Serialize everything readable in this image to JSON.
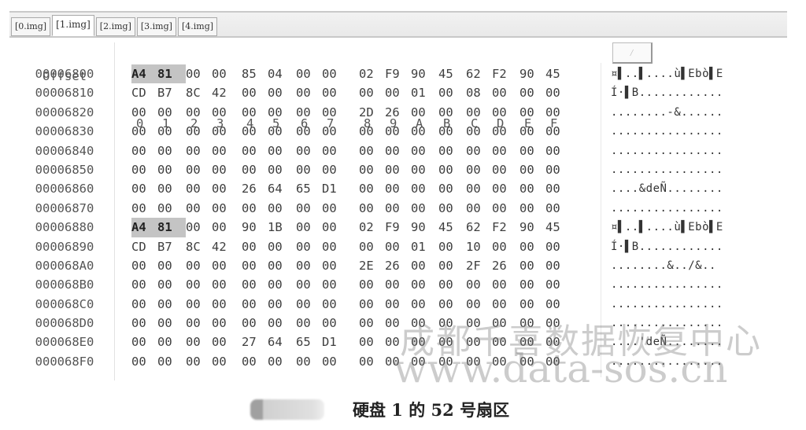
{
  "tabs": [
    {
      "label": "[0.img]",
      "active": false
    },
    {
      "label": "[1.img]",
      "active": true
    },
    {
      "label": "[2.img]",
      "active": false
    },
    {
      "label": "[3.img]",
      "active": false
    },
    {
      "label": "[4.img]",
      "active": false
    }
  ],
  "header": {
    "offset_label": "Offset",
    "columns": [
      "0",
      "1",
      "2",
      "3",
      "4",
      "5",
      "6",
      "7",
      "8",
      "9",
      "A",
      "B",
      "C",
      "D",
      "E",
      "F"
    ],
    "ascii_box_glyph": "⁄"
  },
  "rows": [
    {
      "offset": "00006800",
      "bytes": [
        "A4",
        "81",
        "00",
        "00",
        "85",
        "04",
        "00",
        "00",
        "02",
        "F9",
        "90",
        "45",
        "62",
        "F2",
        "90",
        "45"
      ],
      "highlight": [
        0,
        1
      ],
      "ascii": "¤▌..▌....ù▌Ebò▌E"
    },
    {
      "offset": "00006810",
      "bytes": [
        "CD",
        "B7",
        "8C",
        "42",
        "00",
        "00",
        "00",
        "00",
        "00",
        "00",
        "01",
        "00",
        "08",
        "00",
        "00",
        "00"
      ],
      "highlight": [],
      "ascii": "Í·▌B............"
    },
    {
      "offset": "00006820",
      "bytes": [
        "00",
        "00",
        "00",
        "00",
        "00",
        "00",
        "00",
        "00",
        "2D",
        "26",
        "00",
        "00",
        "00",
        "00",
        "00",
        "00"
      ],
      "highlight": [],
      "ascii": "........-&......"
    },
    {
      "offset": "00006830",
      "bytes": [
        "00",
        "00",
        "00",
        "00",
        "00",
        "00",
        "00",
        "00",
        "00",
        "00",
        "00",
        "00",
        "00",
        "00",
        "00",
        "00"
      ],
      "highlight": [],
      "ascii": "................"
    },
    {
      "offset": "00006840",
      "bytes": [
        "00",
        "00",
        "00",
        "00",
        "00",
        "00",
        "00",
        "00",
        "00",
        "00",
        "00",
        "00",
        "00",
        "00",
        "00",
        "00"
      ],
      "highlight": [],
      "ascii": "................"
    },
    {
      "offset": "00006850",
      "bytes": [
        "00",
        "00",
        "00",
        "00",
        "00",
        "00",
        "00",
        "00",
        "00",
        "00",
        "00",
        "00",
        "00",
        "00",
        "00",
        "00"
      ],
      "highlight": [],
      "ascii": "................"
    },
    {
      "offset": "00006860",
      "bytes": [
        "00",
        "00",
        "00",
        "00",
        "26",
        "64",
        "65",
        "D1",
        "00",
        "00",
        "00",
        "00",
        "00",
        "00",
        "00",
        "00"
      ],
      "highlight": [],
      "ascii": "....&deÑ........"
    },
    {
      "offset": "00006870",
      "bytes": [
        "00",
        "00",
        "00",
        "00",
        "00",
        "00",
        "00",
        "00",
        "00",
        "00",
        "00",
        "00",
        "00",
        "00",
        "00",
        "00"
      ],
      "highlight": [],
      "ascii": "................"
    },
    {
      "offset": "00006880",
      "bytes": [
        "A4",
        "81",
        "00",
        "00",
        "90",
        "1B",
        "00",
        "00",
        "02",
        "F9",
        "90",
        "45",
        "62",
        "F2",
        "90",
        "45"
      ],
      "highlight": [
        0,
        1
      ],
      "ascii": "¤▌..▌....ù▌Ebò▌E"
    },
    {
      "offset": "00006890",
      "bytes": [
        "CD",
        "B7",
        "8C",
        "42",
        "00",
        "00",
        "00",
        "00",
        "00",
        "00",
        "01",
        "00",
        "10",
        "00",
        "00",
        "00"
      ],
      "highlight": [],
      "ascii": "Í·▌B............"
    },
    {
      "offset": "000068A0",
      "bytes": [
        "00",
        "00",
        "00",
        "00",
        "00",
        "00",
        "00",
        "00",
        "2E",
        "26",
        "00",
        "00",
        "2F",
        "26",
        "00",
        "00"
      ],
      "highlight": [],
      "ascii": "........&../&.."
    },
    {
      "offset": "000068B0",
      "bytes": [
        "00",
        "00",
        "00",
        "00",
        "00",
        "00",
        "00",
        "00",
        "00",
        "00",
        "00",
        "00",
        "00",
        "00",
        "00",
        "00"
      ],
      "highlight": [],
      "ascii": "................"
    },
    {
      "offset": "000068C0",
      "bytes": [
        "00",
        "00",
        "00",
        "00",
        "00",
        "00",
        "00",
        "00",
        "00",
        "00",
        "00",
        "00",
        "00",
        "00",
        "00",
        "00"
      ],
      "highlight": [],
      "ascii": "................"
    },
    {
      "offset": "000068D0",
      "bytes": [
        "00",
        "00",
        "00",
        "00",
        "00",
        "00",
        "00",
        "00",
        "00",
        "00",
        "00",
        "00",
        "00",
        "00",
        "00",
        "00"
      ],
      "highlight": [],
      "ascii": "................"
    },
    {
      "offset": "000068E0",
      "bytes": [
        "00",
        "00",
        "00",
        "00",
        "27",
        "64",
        "65",
        "D1",
        "00",
        "00",
        "00",
        "00",
        "00",
        "00",
        "00",
        "00"
      ],
      "highlight": [],
      "ascii": "....'deÑ........"
    },
    {
      "offset": "000068F0",
      "bytes": [
        "00",
        "00",
        "00",
        "00",
        "00",
        "00",
        "00",
        "00",
        "00",
        "00",
        "00",
        "00",
        "00",
        "00",
        "00",
        "00"
      ],
      "highlight": [],
      "ascii": "................"
    }
  ],
  "watermark": {
    "line1": "成都千喜数据恢复中心",
    "line2": "www.data-sos.cn"
  },
  "caption": "硬盘 1 的 52 号扇区"
}
